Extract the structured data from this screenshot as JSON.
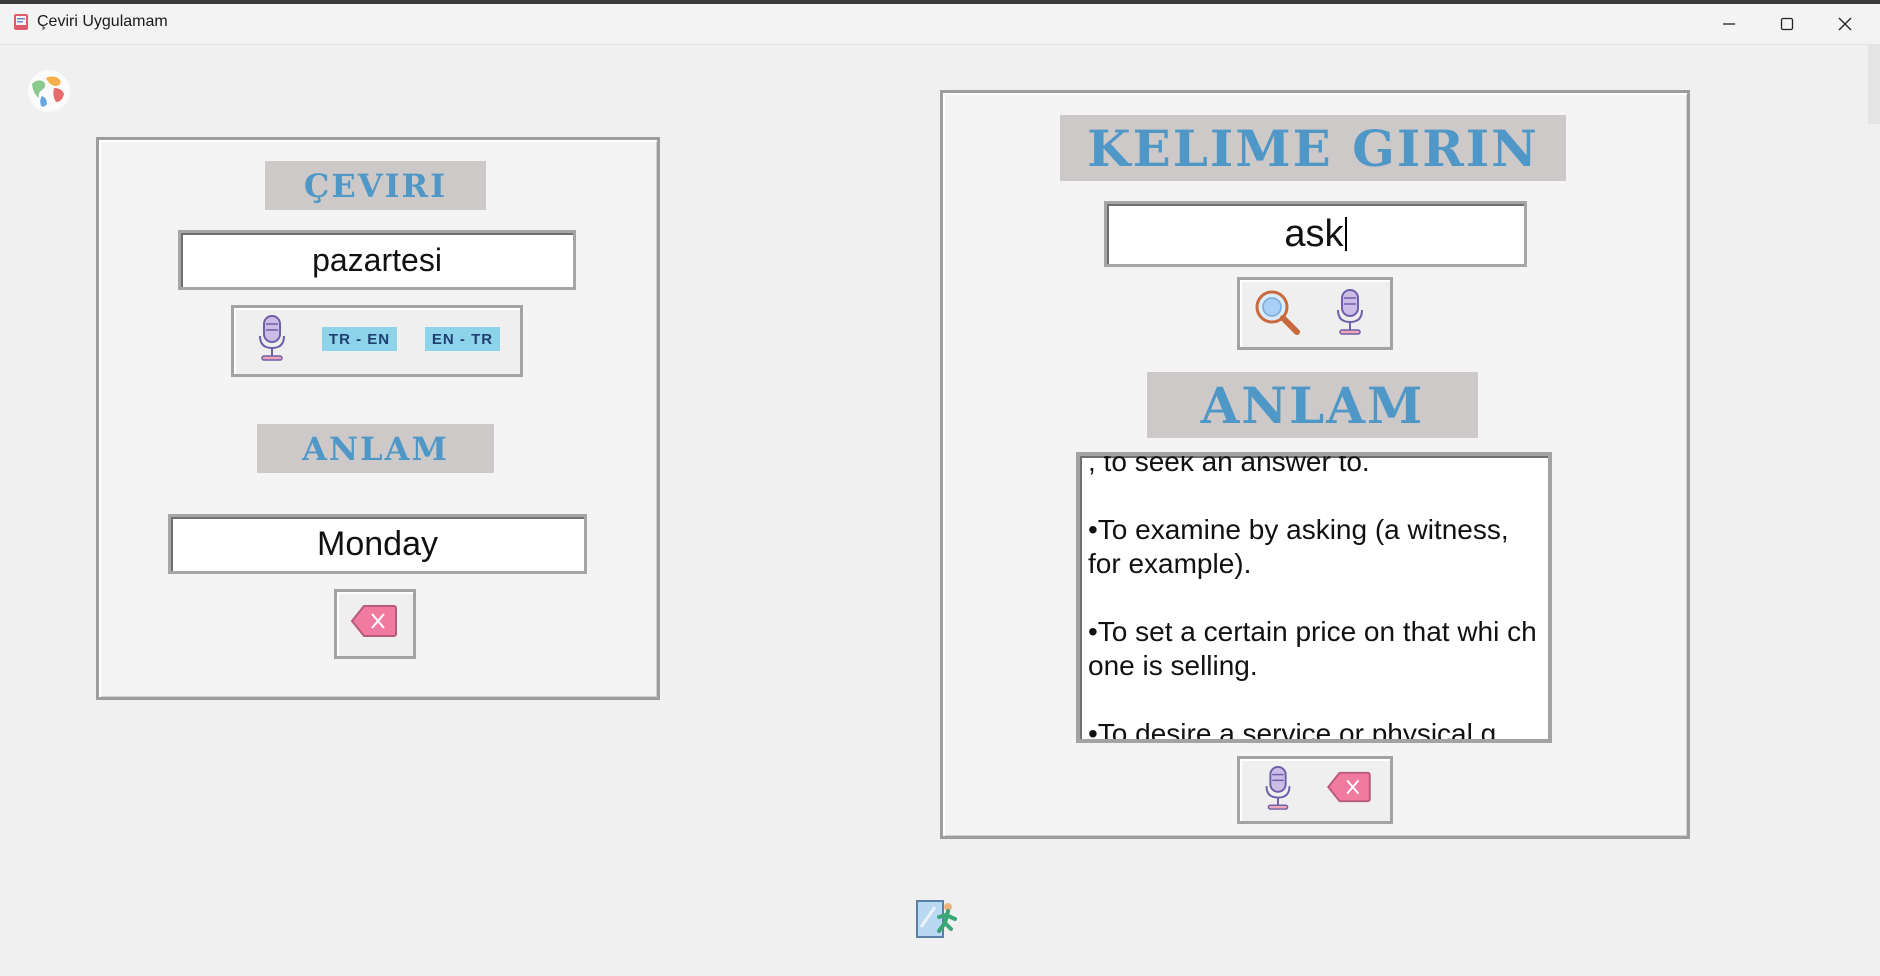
{
  "window": {
    "title": "Çeviri Uygulamam",
    "controls": [
      "minimize",
      "maximize",
      "close"
    ]
  },
  "left_panel": {
    "ceviri_label": "ÇEVIRI",
    "input_value": "pazartesi",
    "buttons": {
      "mic": "microphone-icon",
      "tr_en": "TR - EN",
      "en_tr": "EN - TR"
    },
    "anlam_label": "ANLAM",
    "output_value": "Monday",
    "delete_button": "backspace-icon"
  },
  "right_panel": {
    "kelime_label": "KELIME GIRIN",
    "input_value": "ask",
    "buttons": {
      "search": "magnifier-icon",
      "mic": "microphone-icon"
    },
    "anlam_label": "ANLAM",
    "meanings": [
      ", to seek an answer to.",
      "•To examine by asking (a witness, for example).",
      "•To set a certain price on that whi ch one is selling.",
      "•To desire a service or physical g"
    ],
    "bottom_buttons": {
      "mic": "microphone-icon",
      "delete": "backspace-icon"
    }
  },
  "footer": {
    "exit_icon": "exit-icon"
  },
  "colors": {
    "label_bg": "#cdc9c9",
    "label_text": "#4f97c6",
    "chip_bg": "#8dd3ea",
    "delete_pink": "#f07aa0"
  }
}
